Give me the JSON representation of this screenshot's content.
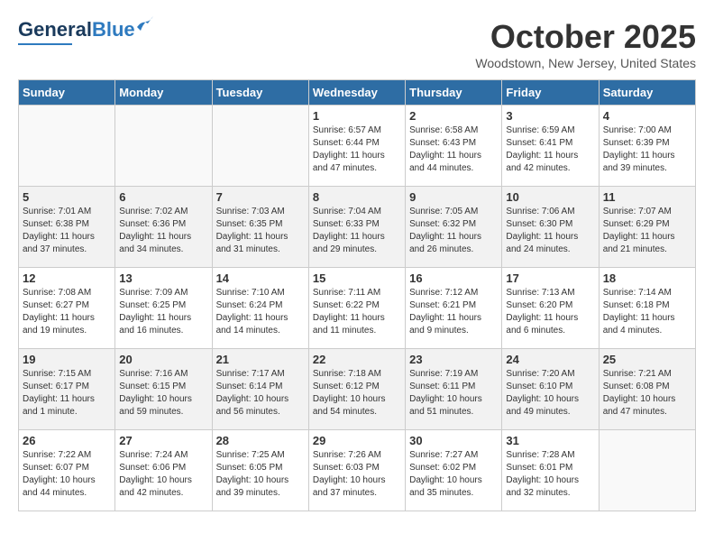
{
  "header": {
    "logo_general": "General",
    "logo_blue": "Blue",
    "month_title": "October 2025",
    "location": "Woodstown, New Jersey, United States"
  },
  "days_of_week": [
    "Sunday",
    "Monday",
    "Tuesday",
    "Wednesday",
    "Thursday",
    "Friday",
    "Saturday"
  ],
  "weeks": [
    [
      {
        "day": "",
        "sunrise": "",
        "sunset": "",
        "daylight": ""
      },
      {
        "day": "",
        "sunrise": "",
        "sunset": "",
        "daylight": ""
      },
      {
        "day": "",
        "sunrise": "",
        "sunset": "",
        "daylight": ""
      },
      {
        "day": "1",
        "sunrise": "Sunrise: 6:57 AM",
        "sunset": "Sunset: 6:44 PM",
        "daylight": "Daylight: 11 hours and 47 minutes."
      },
      {
        "day": "2",
        "sunrise": "Sunrise: 6:58 AM",
        "sunset": "Sunset: 6:43 PM",
        "daylight": "Daylight: 11 hours and 44 minutes."
      },
      {
        "day": "3",
        "sunrise": "Sunrise: 6:59 AM",
        "sunset": "Sunset: 6:41 PM",
        "daylight": "Daylight: 11 hours and 42 minutes."
      },
      {
        "day": "4",
        "sunrise": "Sunrise: 7:00 AM",
        "sunset": "Sunset: 6:39 PM",
        "daylight": "Daylight: 11 hours and 39 minutes."
      }
    ],
    [
      {
        "day": "5",
        "sunrise": "Sunrise: 7:01 AM",
        "sunset": "Sunset: 6:38 PM",
        "daylight": "Daylight: 11 hours and 37 minutes."
      },
      {
        "day": "6",
        "sunrise": "Sunrise: 7:02 AM",
        "sunset": "Sunset: 6:36 PM",
        "daylight": "Daylight: 11 hours and 34 minutes."
      },
      {
        "day": "7",
        "sunrise": "Sunrise: 7:03 AM",
        "sunset": "Sunset: 6:35 PM",
        "daylight": "Daylight: 11 hours and 31 minutes."
      },
      {
        "day": "8",
        "sunrise": "Sunrise: 7:04 AM",
        "sunset": "Sunset: 6:33 PM",
        "daylight": "Daylight: 11 hours and 29 minutes."
      },
      {
        "day": "9",
        "sunrise": "Sunrise: 7:05 AM",
        "sunset": "Sunset: 6:32 PM",
        "daylight": "Daylight: 11 hours and 26 minutes."
      },
      {
        "day": "10",
        "sunrise": "Sunrise: 7:06 AM",
        "sunset": "Sunset: 6:30 PM",
        "daylight": "Daylight: 11 hours and 24 minutes."
      },
      {
        "day": "11",
        "sunrise": "Sunrise: 7:07 AM",
        "sunset": "Sunset: 6:29 PM",
        "daylight": "Daylight: 11 hours and 21 minutes."
      }
    ],
    [
      {
        "day": "12",
        "sunrise": "Sunrise: 7:08 AM",
        "sunset": "Sunset: 6:27 PM",
        "daylight": "Daylight: 11 hours and 19 minutes."
      },
      {
        "day": "13",
        "sunrise": "Sunrise: 7:09 AM",
        "sunset": "Sunset: 6:25 PM",
        "daylight": "Daylight: 11 hours and 16 minutes."
      },
      {
        "day": "14",
        "sunrise": "Sunrise: 7:10 AM",
        "sunset": "Sunset: 6:24 PM",
        "daylight": "Daylight: 11 hours and 14 minutes."
      },
      {
        "day": "15",
        "sunrise": "Sunrise: 7:11 AM",
        "sunset": "Sunset: 6:22 PM",
        "daylight": "Daylight: 11 hours and 11 minutes."
      },
      {
        "day": "16",
        "sunrise": "Sunrise: 7:12 AM",
        "sunset": "Sunset: 6:21 PM",
        "daylight": "Daylight: 11 hours and 9 minutes."
      },
      {
        "day": "17",
        "sunrise": "Sunrise: 7:13 AM",
        "sunset": "Sunset: 6:20 PM",
        "daylight": "Daylight: 11 hours and 6 minutes."
      },
      {
        "day": "18",
        "sunrise": "Sunrise: 7:14 AM",
        "sunset": "Sunset: 6:18 PM",
        "daylight": "Daylight: 11 hours and 4 minutes."
      }
    ],
    [
      {
        "day": "19",
        "sunrise": "Sunrise: 7:15 AM",
        "sunset": "Sunset: 6:17 PM",
        "daylight": "Daylight: 11 hours and 1 minute."
      },
      {
        "day": "20",
        "sunrise": "Sunrise: 7:16 AM",
        "sunset": "Sunset: 6:15 PM",
        "daylight": "Daylight: 10 hours and 59 minutes."
      },
      {
        "day": "21",
        "sunrise": "Sunrise: 7:17 AM",
        "sunset": "Sunset: 6:14 PM",
        "daylight": "Daylight: 10 hours and 56 minutes."
      },
      {
        "day": "22",
        "sunrise": "Sunrise: 7:18 AM",
        "sunset": "Sunset: 6:12 PM",
        "daylight": "Daylight: 10 hours and 54 minutes."
      },
      {
        "day": "23",
        "sunrise": "Sunrise: 7:19 AM",
        "sunset": "Sunset: 6:11 PM",
        "daylight": "Daylight: 10 hours and 51 minutes."
      },
      {
        "day": "24",
        "sunrise": "Sunrise: 7:20 AM",
        "sunset": "Sunset: 6:10 PM",
        "daylight": "Daylight: 10 hours and 49 minutes."
      },
      {
        "day": "25",
        "sunrise": "Sunrise: 7:21 AM",
        "sunset": "Sunset: 6:08 PM",
        "daylight": "Daylight: 10 hours and 47 minutes."
      }
    ],
    [
      {
        "day": "26",
        "sunrise": "Sunrise: 7:22 AM",
        "sunset": "Sunset: 6:07 PM",
        "daylight": "Daylight: 10 hours and 44 minutes."
      },
      {
        "day": "27",
        "sunrise": "Sunrise: 7:24 AM",
        "sunset": "Sunset: 6:06 PM",
        "daylight": "Daylight: 10 hours and 42 minutes."
      },
      {
        "day": "28",
        "sunrise": "Sunrise: 7:25 AM",
        "sunset": "Sunset: 6:05 PM",
        "daylight": "Daylight: 10 hours and 39 minutes."
      },
      {
        "day": "29",
        "sunrise": "Sunrise: 7:26 AM",
        "sunset": "Sunset: 6:03 PM",
        "daylight": "Daylight: 10 hours and 37 minutes."
      },
      {
        "day": "30",
        "sunrise": "Sunrise: 7:27 AM",
        "sunset": "Sunset: 6:02 PM",
        "daylight": "Daylight: 10 hours and 35 minutes."
      },
      {
        "day": "31",
        "sunrise": "Sunrise: 7:28 AM",
        "sunset": "Sunset: 6:01 PM",
        "daylight": "Daylight: 10 hours and 32 minutes."
      },
      {
        "day": "",
        "sunrise": "",
        "sunset": "",
        "daylight": ""
      }
    ]
  ]
}
